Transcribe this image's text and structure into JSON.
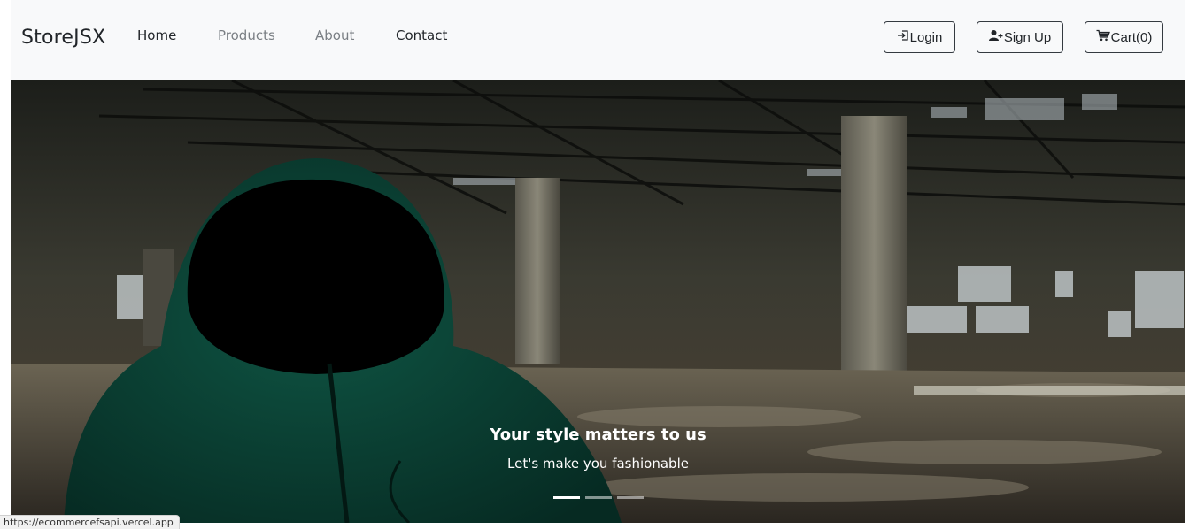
{
  "brand": "StoreJSX",
  "nav": {
    "home": "Home",
    "products": "Products",
    "about": "About",
    "contact": "Contact"
  },
  "buttons": {
    "login": "Login",
    "signup": "Sign Up",
    "cart": "Cart(0)"
  },
  "hero": {
    "title": "Your style matters to us",
    "subtitle": "Let's make you fashionable",
    "slides_count": 3,
    "active_slide": 1
  },
  "status_url": "https://ecommercefsapi.vercel.app",
  "colors": {
    "navbar_bg": "#f8f9fa",
    "text_dark": "#212529",
    "text_muted": "#7a7f84",
    "hoodie": "#0b3b30"
  },
  "icons": {
    "login": "login-icon",
    "signup": "user-plus-icon",
    "cart": "cart-icon"
  }
}
